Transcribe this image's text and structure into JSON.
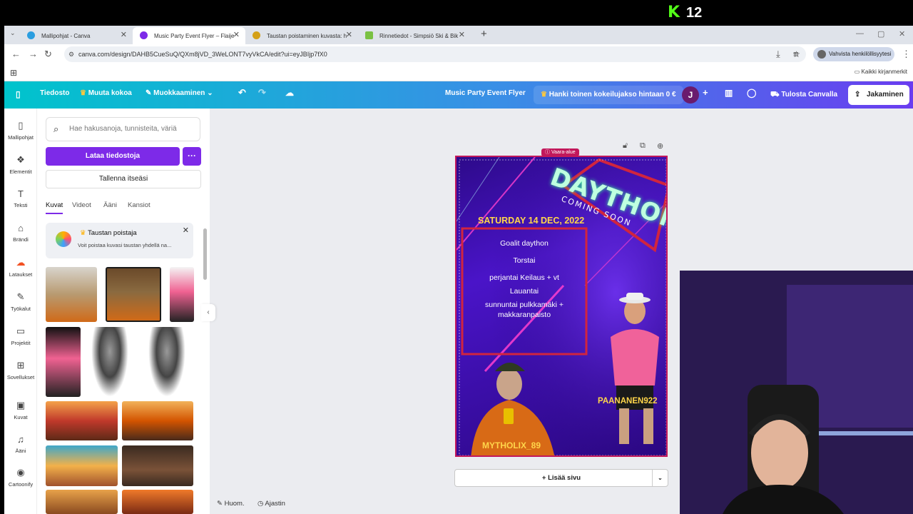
{
  "overlay": {
    "stream_count": "12"
  },
  "browser": {
    "tabs": [
      {
        "label": "Mallipohjat - Canva",
        "active": false
      },
      {
        "label": "Music Party Event Flyer – Flaije",
        "active": true
      },
      {
        "label": "Taustan poistaminen kuvasta: h",
        "active": false
      },
      {
        "label": "Rinnetiedot - Simpsiö Ski & Bik",
        "active": false
      }
    ],
    "url": "canva.com/design/DAHB5CueSuQ/QXm8jVD_3WeLONT7vyVkCA/edit?ui=eyJBIjp7fX0",
    "profile_label": "Vahvista henkilöllisyytesi",
    "bookmarks_label": "Kaikki kirjanmerkit"
  },
  "header": {
    "file": "Tiedosto",
    "resize": "Muuta kokoa",
    "editing": "Muokkaaminen",
    "title": "Music Party Event Flyer",
    "trial": "Hanki toinen kokeilujakso hintaan 0 €",
    "avatar_letter": "J",
    "print": "Tulosta Canvalla",
    "share": "Jakaminen"
  },
  "rail": [
    {
      "icon": "template-icon",
      "glyph": "▯",
      "label": "Mallipohjat"
    },
    {
      "icon": "elements-icon",
      "glyph": "❖",
      "label": "Elementit"
    },
    {
      "icon": "text-icon",
      "glyph": "T",
      "label": "Teksti"
    },
    {
      "icon": "brand-icon",
      "glyph": "⌂",
      "label": "Brändi"
    },
    {
      "icon": "uploads-icon",
      "glyph": "☁",
      "label": "Lataukset"
    },
    {
      "icon": "tools-icon",
      "glyph": "✎",
      "label": "Työkalut"
    },
    {
      "icon": "projects-icon",
      "glyph": "▭",
      "label": "Projektit"
    },
    {
      "icon": "apps-icon",
      "glyph": "⊞",
      "label": "Sovellukset"
    },
    {
      "icon": "photos-icon",
      "glyph": "▣",
      "label": "Kuvat"
    },
    {
      "icon": "audio-icon",
      "glyph": "♫",
      "label": "Ääni"
    },
    {
      "icon": "cartoonify-icon",
      "glyph": "◉",
      "label": "Cartoonify"
    }
  ],
  "panel": {
    "search_placeholder": "Hae hakusanoja, tunnisteita, väriä",
    "upload": "Lataa tiedostoja",
    "record": "Tallenna itseäsi",
    "tabs": [
      "Kuvat",
      "Videot",
      "Ääni",
      "Kansiot"
    ],
    "promo_title": "Taustan poistaja",
    "promo_desc": "Voit poistaa kuvasi taustan yhdellä na..."
  },
  "flyer": {
    "warning": "Vaara-alue",
    "headline": "DAYTHON",
    "subheadline": "COMING SOON",
    "date": "SATURDAY 14 DEC, 2022",
    "lines": [
      "Goalit daython",
      "Torstai",
      "perjantai Keilaus + vt",
      "Lauantai",
      "sunnuntai pulkkamäki +",
      "makkaranpaisto"
    ],
    "name_left": "MYTHOLIX_89",
    "name_right": "PAANANEN922"
  },
  "canvas": {
    "add_page": "+ Lisää sivu"
  },
  "footer": {
    "notes": "Huom.",
    "timer": "Ajastin"
  },
  "colors": {
    "brand_purple": "#7d2ae8",
    "flyer_bg": "#3b0ea8",
    "danger": "#c2185b"
  }
}
